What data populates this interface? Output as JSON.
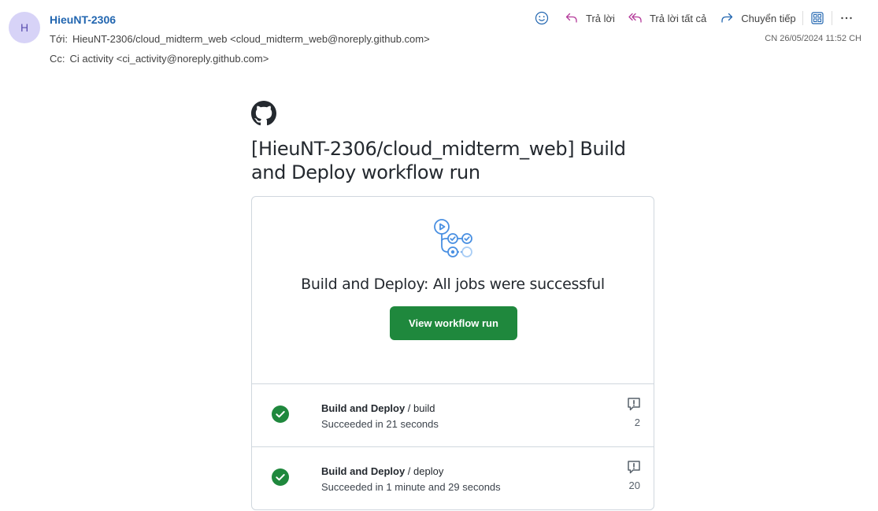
{
  "header": {
    "avatar_initial": "H",
    "sender": "HieuNT-2306",
    "to_label": "Tới:",
    "to_value": "HieuNT-2306/cloud_midterm_web <cloud_midterm_web@noreply.github.com>",
    "cc_label": "Cc:",
    "cc_value": "Ci activity <ci_activity@noreply.github.com>",
    "datetime": "CN 26/05/2024 11:52 CH"
  },
  "toolbar": {
    "reply": "Trả lời",
    "reply_all": "Trả lời tất cả",
    "forward": "Chuyển tiếp"
  },
  "email": {
    "title": "[HieuNT-2306/cloud_midterm_web] Build and Deploy workflow run",
    "heading": "Build and Deploy: All jobs were successful",
    "button": "View workflow run"
  },
  "jobs": [
    {
      "workflow": "Build and Deploy",
      "separator": " / ",
      "job": "build",
      "status": "Succeeded in 21 seconds",
      "annotations": "2"
    },
    {
      "workflow": "Build and Deploy",
      "separator": " / ",
      "job": "deploy",
      "status": "Succeeded in 1 minute and 29 seconds",
      "annotations": "20"
    }
  ],
  "colors": {
    "accent": "#2266b0",
    "success": "#1f883d",
    "border": "#d0d7de"
  }
}
